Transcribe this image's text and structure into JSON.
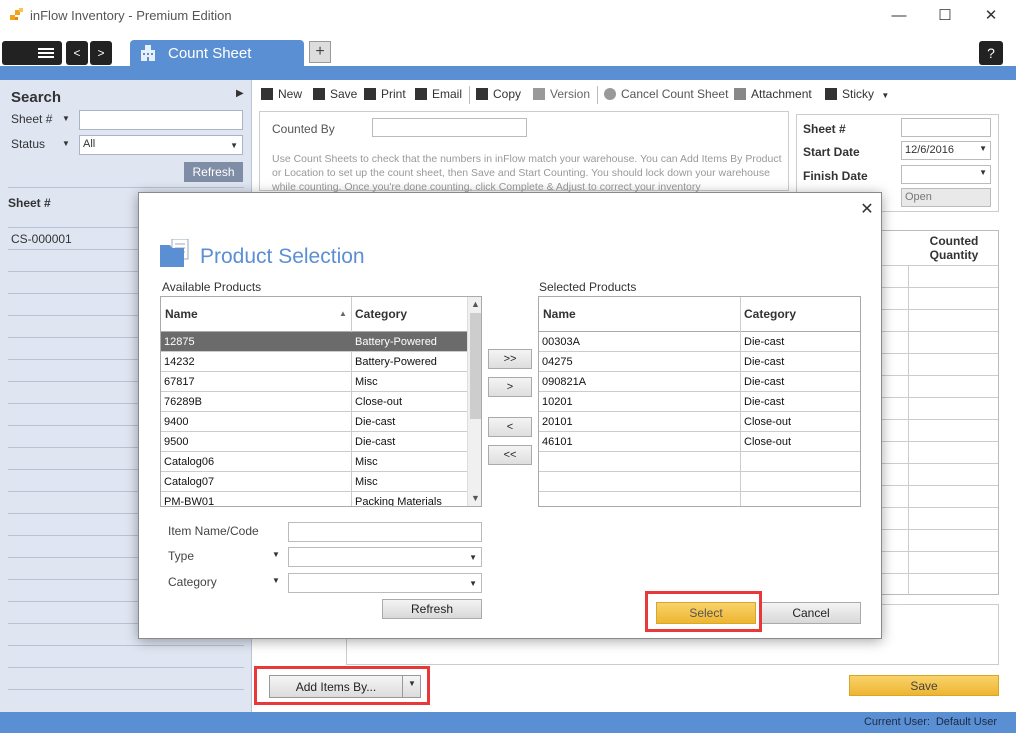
{
  "app": {
    "title": "inFlow Inventory - Premium Edition"
  },
  "window_controls": {
    "minimize": "—",
    "maximize": "☐",
    "close": "✕"
  },
  "tabs": {
    "active_label": "Count Sheet",
    "add_label": "+",
    "help_label": "?"
  },
  "nav": {
    "back": "<",
    "forward": ">"
  },
  "search": {
    "title": "Search",
    "collapse": "▶",
    "sheet_label": "Sheet #",
    "sheet_value": "",
    "status_label": "Status",
    "status_value": "All",
    "refresh_label": "Refresh",
    "list_header": "Sheet #",
    "rows": [
      "CS-000001"
    ]
  },
  "toolbar": {
    "new": "New",
    "save": "Save",
    "print": "Print",
    "email": "Email",
    "copy": "Copy",
    "version": "Version",
    "cancel_sheet": "Cancel Count Sheet",
    "attachment": "Attachment",
    "sticky": "Sticky",
    "sticky_arrow": "▼"
  },
  "form": {
    "counted_by_label": "Counted By",
    "counted_by_value": "",
    "help_text": "Use Count Sheets to check that the numbers in inFlow match your warehouse.  You can Add Items By Product or Location to set up the count sheet, then Save and Start Counting.  You should lock down your warehouse while counting.  Once you're done counting, click Complete & Adjust to correct your inventory"
  },
  "sheet_info": {
    "sheet_label": "Sheet #",
    "sheet_value": "",
    "start_label": "Start Date",
    "start_value": "12/6/2016",
    "finish_label": "Finish Date",
    "finish_value": "",
    "status_value": "Open"
  },
  "count_grid": {
    "header": "Counted Quantity"
  },
  "bottom": {
    "add_items_label": "Add Items By...",
    "save_label": "Save"
  },
  "statusbar": {
    "current_user_label": "Current User:",
    "current_user_value": "Default User"
  },
  "dialog": {
    "title": "Product Selection",
    "close": "✕",
    "available_label": "Available Products",
    "selected_label": "Selected Products",
    "col_name": "Name",
    "col_category": "Category",
    "sort_indicator": "▲",
    "available": [
      {
        "name": "12875",
        "category": "Battery-Powered",
        "selected": true
      },
      {
        "name": "14232",
        "category": "Battery-Powered"
      },
      {
        "name": "67817",
        "category": "Misc"
      },
      {
        "name": "76289B",
        "category": "Close-out"
      },
      {
        "name": "9400",
        "category": "Die-cast"
      },
      {
        "name": "9500",
        "category": "Die-cast"
      },
      {
        "name": "Catalog06",
        "category": "Misc"
      },
      {
        "name": "Catalog07",
        "category": "Misc"
      },
      {
        "name": "PM-BW01",
        "category": "Packing Materials"
      }
    ],
    "selected": [
      {
        "name": "00303A",
        "category": "Die-cast"
      },
      {
        "name": "04275",
        "category": "Die-cast"
      },
      {
        "name": "090821A",
        "category": "Die-cast"
      },
      {
        "name": "10201",
        "category": "Die-cast"
      },
      {
        "name": "20101",
        "category": "Close-out"
      },
      {
        "name": "46101",
        "category": "Close-out"
      }
    ],
    "move_all_right": ">>",
    "move_right": ">",
    "move_left": "<",
    "move_all_left": "<<",
    "filter_item_label": "Item Name/Code",
    "filter_type_label": "Type",
    "filter_category_label": "Category",
    "refresh_label": "Refresh",
    "select_label": "Select",
    "cancel_label": "Cancel"
  },
  "colors": {
    "accent": "#5b8fd3",
    "highlight": "#e8383a",
    "primary_button": "#f2c14e"
  }
}
